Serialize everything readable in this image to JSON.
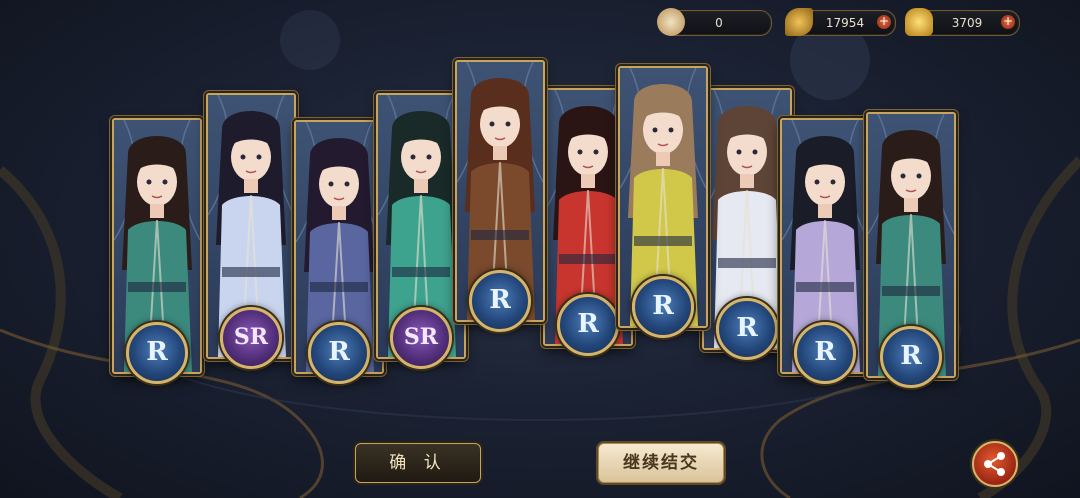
{
  "currency": {
    "token": {
      "icon": "coin-icon",
      "value": "0"
    },
    "feather": {
      "icon": "feather-icon",
      "value": "17954"
    },
    "ingot": {
      "icon": "gold-ingot-icon",
      "value": "3709"
    }
  },
  "cards": [
    {
      "rarity": "R",
      "hair": "#2a1c18",
      "robe": "#3b8a7d"
    },
    {
      "rarity": "SR",
      "hair": "#1e1c2c",
      "robe": "#c9d4ee"
    },
    {
      "rarity": "R",
      "hair": "#231a30",
      "robe": "#5966a0"
    },
    {
      "rarity": "SR",
      "hair": "#1a2a28",
      "robe": "#3ea38e"
    },
    {
      "rarity": "R",
      "hair": "#5a2e1c",
      "robe": "#7b4a2c"
    },
    {
      "rarity": "R",
      "hair": "#2b1414",
      "robe": "#c8352e"
    },
    {
      "rarity": "R",
      "hair": "#9a7c5d",
      "robe": "#d1c84a"
    },
    {
      "rarity": "R",
      "hair": "#5d4436",
      "robe": "#e6e8f2"
    },
    {
      "rarity": "R",
      "hair": "#1a1c28",
      "robe": "#b5a8d8"
    },
    {
      "rarity": "R",
      "hair": "#2a1c18",
      "robe": "#3b8a7d"
    }
  ],
  "buttons": {
    "confirm": "确 认",
    "continue": "继续结交"
  },
  "colors": {
    "gold": "#c9a45c",
    "r_badge": "#24487c",
    "sr_badge": "#54307c"
  }
}
